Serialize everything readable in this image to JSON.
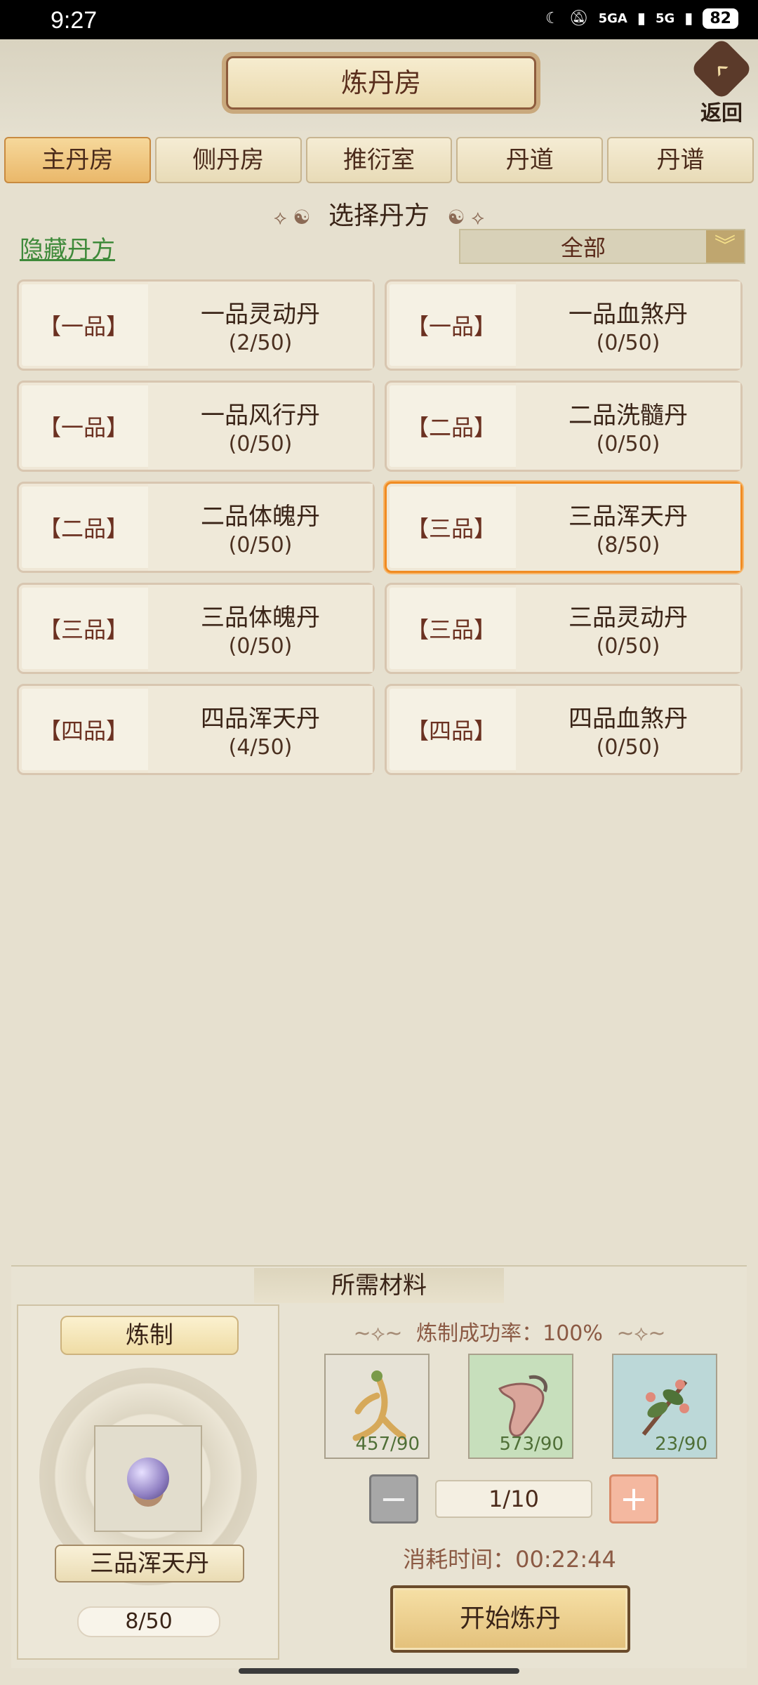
{
  "status": {
    "time": "9:27",
    "network1": "5GA",
    "network2": "5G",
    "battery": "82"
  },
  "header": {
    "title": "炼丹房",
    "back_label": "返回"
  },
  "tabs": [
    {
      "label": "主丹房",
      "active": true
    },
    {
      "label": "侧丹房",
      "active": false
    },
    {
      "label": "推衍室",
      "active": false
    },
    {
      "label": "丹道",
      "active": false
    },
    {
      "label": "丹谱",
      "active": false
    }
  ],
  "recipe_section": {
    "title": "选择丹方",
    "hide_link": "隐藏丹方",
    "filter": {
      "selected": "全部"
    }
  },
  "recipes": [
    {
      "grade": "【一品】",
      "name": "一品灵动丹",
      "count": "(2/50)",
      "selected": false
    },
    {
      "grade": "【一品】",
      "name": "一品血煞丹",
      "count": "(0/50)",
      "selected": false
    },
    {
      "grade": "【一品】",
      "name": "一品风行丹",
      "count": "(0/50)",
      "selected": false
    },
    {
      "grade": "【二品】",
      "name": "二品洗髓丹",
      "count": "(0/50)",
      "selected": false
    },
    {
      "grade": "【二品】",
      "name": "二品体魄丹",
      "count": "(0/50)",
      "selected": false
    },
    {
      "grade": "【三品】",
      "name": "三品浑天丹",
      "count": "(8/50)",
      "selected": true
    },
    {
      "grade": "【三品】",
      "name": "三品体魄丹",
      "count": "(0/50)",
      "selected": false
    },
    {
      "grade": "【三品】",
      "name": "三品灵动丹",
      "count": "(0/50)",
      "selected": false
    },
    {
      "grade": "【四品】",
      "name": "四品浑天丹",
      "count": "(4/50)",
      "selected": false
    },
    {
      "grade": "【四品】",
      "name": "四品血煞丹",
      "count": "(0/50)",
      "selected": false
    }
  ],
  "materials_panel": {
    "title": "所需材料",
    "refine_label": "炼制",
    "pill_name": "三品浑天丹",
    "pill_progress": "8/50",
    "success_rate": "炼制成功率：100%",
    "materials": [
      {
        "icon": "ginseng-root-icon",
        "qty": "457/90"
      },
      {
        "icon": "dried-root-icon",
        "qty": "573/90"
      },
      {
        "icon": "herb-branch-icon",
        "qty": "23/90"
      }
    ],
    "stepper_value": "1/10",
    "consume_time": "消耗时间：00:22:44",
    "start_button": "开始炼丹"
  }
}
